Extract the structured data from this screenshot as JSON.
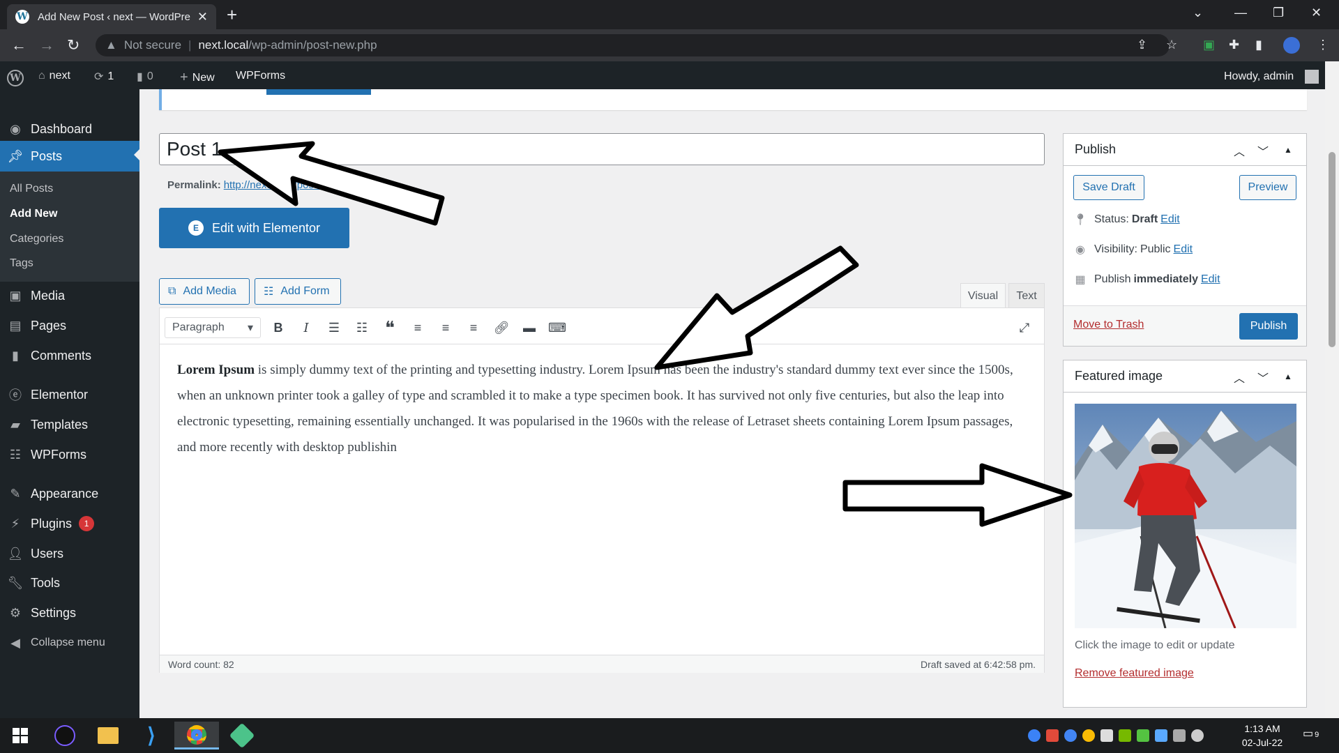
{
  "browser": {
    "tab_title": "Add New Post ‹ next — WordPre",
    "address_prefix": "Not secure",
    "address_host": "next.local",
    "address_path": "/wp-admin/post-new.php"
  },
  "adminbar": {
    "site_name": "next",
    "updates_count": "1",
    "comments_count": "0",
    "new_label": "New",
    "wpforms_label": "WPForms",
    "howdy": "Howdy, admin"
  },
  "sidebar": {
    "items": [
      {
        "label": "Dashboard",
        "icon": "dashboard-icon"
      },
      {
        "label": "Posts",
        "icon": "pin-icon"
      },
      {
        "label": "Media",
        "icon": "media-icon"
      },
      {
        "label": "Pages",
        "icon": "pages-icon"
      },
      {
        "label": "Comments",
        "icon": "comment-icon"
      },
      {
        "label": "Elementor",
        "icon": "elementor-icon"
      },
      {
        "label": "Templates",
        "icon": "folder-icon"
      },
      {
        "label": "WPForms",
        "icon": "form-icon"
      },
      {
        "label": "Appearance",
        "icon": "brush-icon"
      },
      {
        "label": "Plugins",
        "icon": "plugin-icon"
      },
      {
        "label": "Users",
        "icon": "user-icon"
      },
      {
        "label": "Tools",
        "icon": "wrench-icon"
      },
      {
        "label": "Settings",
        "icon": "settings-icon"
      },
      {
        "label": "Collapse menu",
        "icon": "collapse-icon"
      }
    ],
    "posts_submenu": [
      "All Posts",
      "Add New",
      "Categories",
      "Tags"
    ],
    "plugins_badge": "1"
  },
  "editor": {
    "title_value": "Post 1",
    "permalink_label": "Permalink:",
    "permalink_url": "http://next.local/post-1/",
    "permalink_edit": "Edit",
    "elementor_button": "Edit with Elementor",
    "add_media": "Add Media",
    "add_form": "Add Form",
    "tab_visual": "Visual",
    "tab_text": "Text",
    "format_select": "Paragraph",
    "content_bold": "Lorem Ipsum",
    "content_rest": " is simply dummy text of the printing and typesetting industry. Lorem Ipsum has been the industry's standard dummy text ever since the 1500s, when an unknown printer took a galley of type and scrambled it to make a type specimen book. It has survived not only five centuries, but also the leap into electronic typesetting, remaining essentially unchanged. It was popularised in the 1960s with the release of Letraset sheets containing Lorem Ipsum passages, and more recently with desktop publishin",
    "word_count": "Word count: 82",
    "draft_saved": "Draft saved at 6:42:58 pm."
  },
  "publish_box": {
    "title": "Publish",
    "save_draft": "Save Draft",
    "preview": "Preview",
    "status_label": "Status:",
    "status_value": "Draft",
    "visibility_label": "Visibility:",
    "visibility_value": "Public",
    "publish_label": "Publish",
    "publish_value": "immediately",
    "edit": "Edit",
    "move_to_trash": "Move to Trash",
    "publish_button": "Publish"
  },
  "featured_box": {
    "title": "Featured image",
    "hint": "Click the image to edit or update",
    "remove": "Remove featured image"
  },
  "taskbar": {
    "time": "1:13 AM",
    "date": "02-Jul-22",
    "notifications": "9"
  },
  "colors": {
    "wp_blue": "#2271b1",
    "admin_dark": "#1d2327",
    "trash_red": "#b32d2e"
  }
}
